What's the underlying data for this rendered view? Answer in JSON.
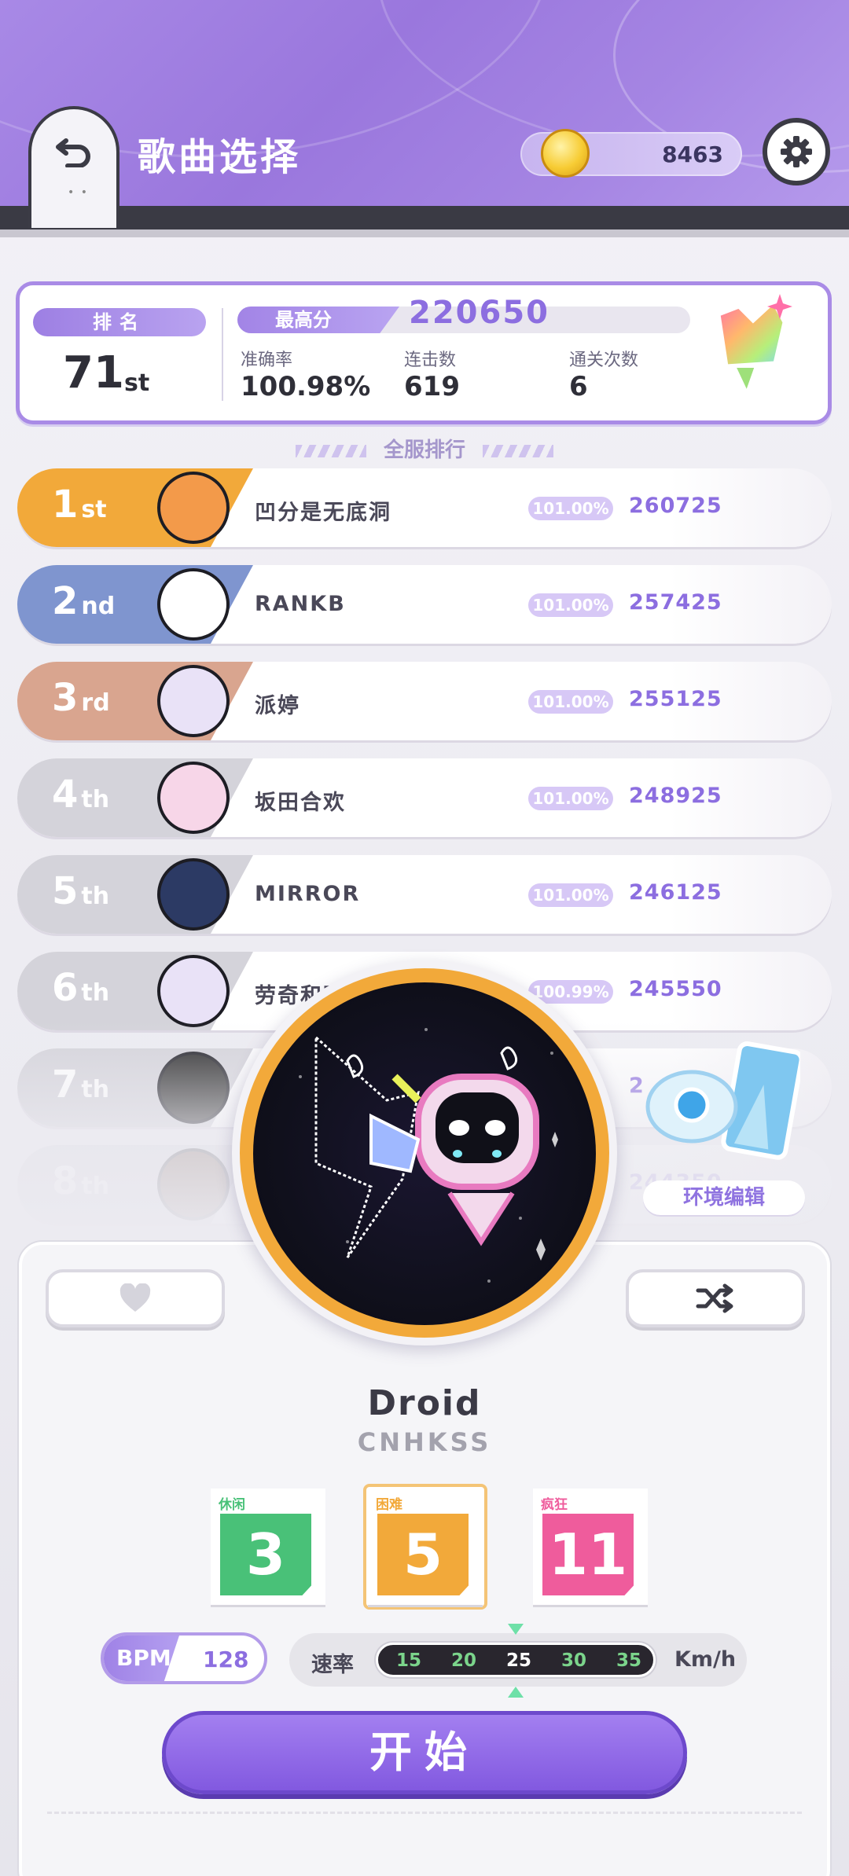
{
  "header": {
    "title": "歌曲选择",
    "coins": "8463"
  },
  "stats": {
    "rank_label": "排名",
    "rank_value": "71",
    "rank_suffix": "st",
    "best_label": "最高分",
    "best_value": "220650",
    "accuracy_label": "准确率",
    "accuracy_value": "100.98%",
    "combo_label": "连击数",
    "combo_value": "619",
    "clears_label": "通关次数",
    "clears_value": "6"
  },
  "leaderboard_title": "全服排行",
  "leaderboard": [
    {
      "rank": "1",
      "suffix": "st",
      "name": "凹分是无底洞",
      "acc": "101.00%",
      "score": "260725",
      "color": "#f2a93a"
    },
    {
      "rank": "2",
      "suffix": "nd",
      "name": "RANKB",
      "acc": "101.00%",
      "score": "257425",
      "color": "#7f95cf"
    },
    {
      "rank": "3",
      "suffix": "rd",
      "name": "派婷",
      "acc": "101.00%",
      "score": "255125",
      "color": "#d9a58f"
    },
    {
      "rank": "4",
      "suffix": "th",
      "name": "坂田合欢",
      "acc": "101.00%",
      "score": "248925",
      "color": "#d4d3da"
    },
    {
      "rank": "5",
      "suffix": "th",
      "name": "MIRROR",
      "acc": "101.00%",
      "score": "246125",
      "color": "#d4d3da"
    },
    {
      "rank": "6",
      "suffix": "th",
      "name": "劳奇和晓星",
      "acc": "100.99%",
      "score": "245550",
      "color": "#d4d3da"
    },
    {
      "rank": "7",
      "suffix": "th",
      "name": "",
      "acc": "",
      "score": "2",
      "color": "#d4d3da"
    },
    {
      "rank": "8",
      "suffix": "th",
      "name": "",
      "acc": "",
      "score": "244350",
      "color": "#d4d3da"
    }
  ],
  "environment_label": "环境编辑",
  "song": {
    "title": "Droid",
    "artist": "CNHKSS"
  },
  "difficulties": [
    {
      "label": "休闲",
      "level": "3",
      "color": "#49c178"
    },
    {
      "label": "困难",
      "level": "5",
      "color": "#f2a93a"
    },
    {
      "label": "疯狂",
      "level": "11",
      "color": "#ef5c9c"
    }
  ],
  "bpm": {
    "label": "BPM",
    "value": "128"
  },
  "speed": {
    "label": "速率",
    "unit": "Km/h",
    "options": [
      "15",
      "20",
      "25",
      "30",
      "35"
    ],
    "selected": "25"
  },
  "start_label": "开始",
  "colors": {
    "accent": "#9a77dd",
    "score": "#8c6ee0"
  }
}
